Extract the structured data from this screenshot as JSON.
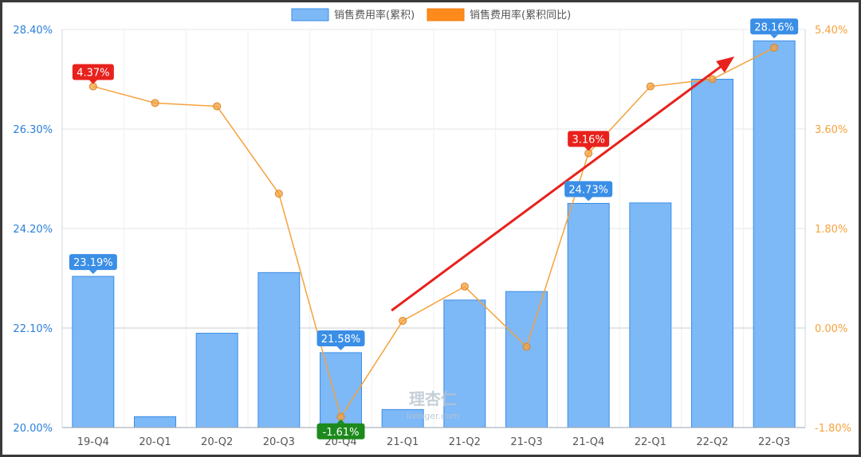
{
  "chart_data": {
    "type": "bar",
    "categories": [
      "19-Q4",
      "20-Q1",
      "20-Q2",
      "20-Q3",
      "20-Q4",
      "21-Q1",
      "21-Q2",
      "21-Q3",
      "21-Q4",
      "22-Q1",
      "22-Q2",
      "22-Q3"
    ],
    "series": [
      {
        "name": "销售费用率(累积)",
        "type": "bar",
        "axis": "left",
        "color": "#7db8f7",
        "values": [
          23.19,
          20.23,
          21.99,
          23.27,
          21.58,
          20.38,
          22.69,
          22.87,
          24.73,
          24.74,
          27.35,
          28.16
        ]
      },
      {
        "name": "销售费用率(累积同比)",
        "type": "line",
        "axis": "right",
        "color": "#f5a23c",
        "values": [
          4.37,
          4.07,
          4.01,
          2.43,
          -1.61,
          0.13,
          0.75,
          -0.34,
          3.16,
          4.37,
          4.5,
          5.07
        ]
      }
    ],
    "y_left": {
      "range": [
        20.0,
        28.4
      ],
      "ticks": [
        "20.00%",
        "22.10%",
        "24.20%",
        "26.30%",
        "28.40%"
      ]
    },
    "y_right": {
      "range": [
        -1.8,
        5.4
      ],
      "ticks": [
        "-1.80%",
        "0.00%",
        "1.80%",
        "3.60%",
        "5.40%"
      ]
    },
    "data_labels": [
      {
        "series": 0,
        "index": 0,
        "text": "23.19%",
        "color": "#3a8ee6"
      },
      {
        "series": 0,
        "index": 4,
        "text": "21.58%",
        "color": "#3a8ee6"
      },
      {
        "series": 0,
        "index": 8,
        "text": "24.73%",
        "color": "#3a8ee6"
      },
      {
        "series": 0,
        "index": 11,
        "text": "28.16%",
        "color": "#3a8ee6"
      },
      {
        "series": 1,
        "index": 0,
        "text": "4.37%",
        "color": "#e8211c"
      },
      {
        "series": 1,
        "index": 8,
        "text": "3.16%",
        "color": "#e8211c"
      },
      {
        "series": 1,
        "index": 4,
        "text": "-1.61%",
        "color": "#1c8a1c"
      }
    ],
    "legend_position": "top-center",
    "grid": true,
    "annotation_arrow": {
      "color": "#e8211c",
      "from_category": "21-Q1",
      "to_category": "22-Q3"
    }
  },
  "watermark": {
    "logo_text": "理杏仁",
    "url_text": "lixinger.com"
  }
}
